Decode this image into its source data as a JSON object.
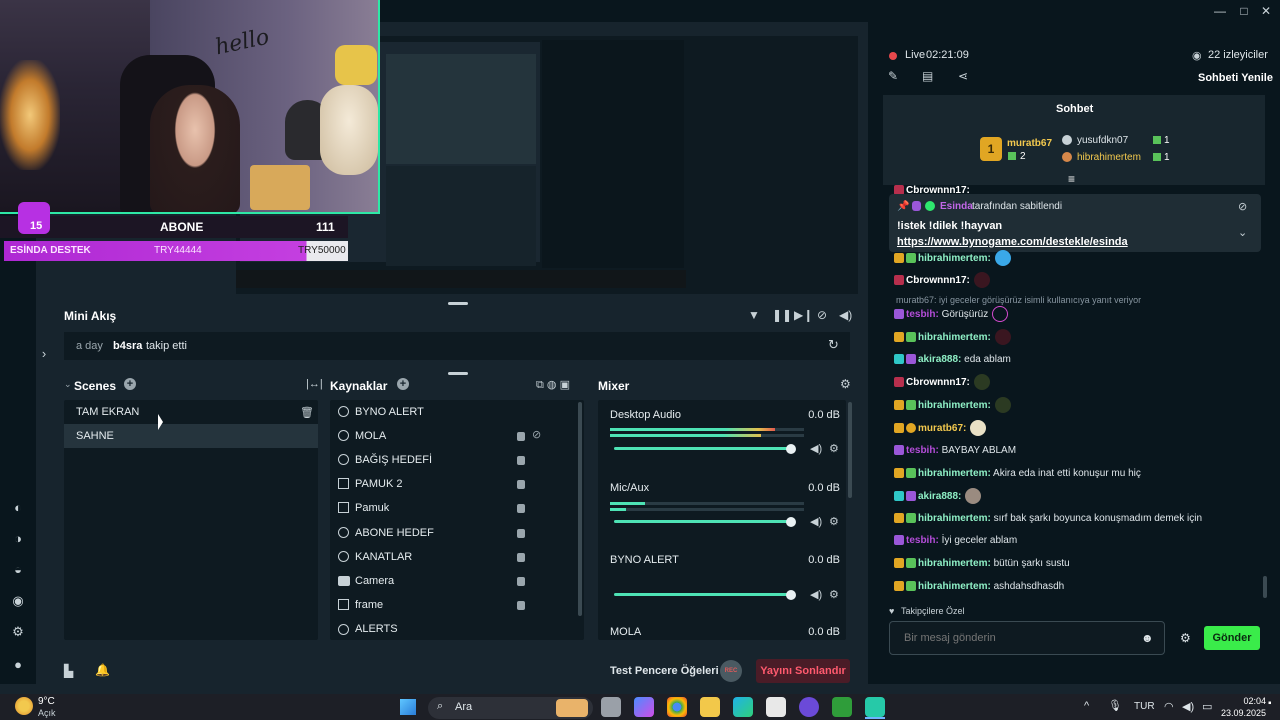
{
  "webcam": {
    "hello_text": "hello",
    "overlay": {
      "badge_number": "15",
      "abone_label": "ABONE",
      "abone_count": "111",
      "destek_label": "ESİNDA DESTEK",
      "destek_amount1": "TRY44444",
      "destek_amount2": "TRY50000"
    }
  },
  "mini_akis": {
    "title": "Mini Akış",
    "time": "a day",
    "user": "b4sra",
    "action": "takip etti"
  },
  "scenes": {
    "title": "Scenes",
    "items": [
      "TAM EKRAN",
      "SAHNE"
    ]
  },
  "sources": {
    "title": "Kaynaklar",
    "items": [
      "BYNO ALERT",
      "MOLA",
      "BAĞIŞ HEDEFİ",
      "PAMUK 2",
      "Pamuk",
      "ABONE HEDEF",
      "KANATLAR",
      "Camera",
      "frame",
      "ALERTS"
    ]
  },
  "mixer": {
    "title": "Mixer",
    "channels": [
      {
        "name": "Desktop Audio",
        "db": "0.0 dB"
      },
      {
        "name": "Mic/Aux",
        "db": "0.0 dB"
      },
      {
        "name": "BYNO ALERT",
        "db": "0.0 dB"
      },
      {
        "name": "MOLA",
        "db": "0.0 dB"
      }
    ]
  },
  "bottom": {
    "test_label": "Test Pencere Öğeleri",
    "rec_label": "REC",
    "end_stream": "Yayını Sonlandır"
  },
  "chat": {
    "live_label": "Live",
    "live_time": "02:21:09",
    "viewers": "22 izleyiciler",
    "refresh": "Sohbeti Yenile",
    "title": "Sohbet",
    "leaderboard": {
      "first_name": "muratb67",
      "first_rank": "1",
      "first_count": "2",
      "second_name": "yusufdkn07",
      "second_count": "1",
      "third_name": "hibrahimertem",
      "third_count": "1"
    },
    "partial_top": "Cbrownnn17:",
    "pinned": {
      "user": "Esinda",
      "suffix": "tarafından sabitlendi",
      "message": "!istek !dilek !hayvan",
      "link": "https://www.bynogame.com/destekle/esinda"
    },
    "reply_context": "muratb67: iyi geceler görüşürüz isimli kullanıcıya yanıt veriyor",
    "messages": [
      {
        "user": "hibrahimertem:",
        "text": ""
      },
      {
        "user": "Cbrownnn17:",
        "text": ""
      },
      {
        "user": "tesbih:",
        "text": "Görüşürüz"
      },
      {
        "user": "hibrahimertem:",
        "text": ""
      },
      {
        "user": "akira888:",
        "text": "eda ablam"
      },
      {
        "user": "Cbrownnn17:",
        "text": ""
      },
      {
        "user": "hibrahimertem:",
        "text": ""
      },
      {
        "user": "muratb67:",
        "text": ""
      },
      {
        "user": "tesbih:",
        "text": "BAYBAY ABLAM"
      },
      {
        "user": "hibrahimertem:",
        "text": "Akira eda inat etti konuşur mu hiç"
      },
      {
        "user": "akira888:",
        "text": ""
      },
      {
        "user": "hibrahimertem:",
        "text": "sırf bak şarkı boyunca konuşmadım demek için"
      },
      {
        "user": "tesbih:",
        "text": "İyi geceler ablam"
      },
      {
        "user": "hibrahimertem:",
        "text": "bütün şarkı sustu"
      },
      {
        "user": "hibrahimertem:",
        "text": "ashdahsdhasdh"
      }
    ],
    "followers_only": "Takipçilere Özel",
    "input_placeholder": "Bir mesaj gönderin",
    "send": "Gönder"
  },
  "taskbar": {
    "weather_temp": "9°C",
    "weather_desc": "Açık",
    "search_label": "Ara",
    "lang": "TUR",
    "time": "02:04",
    "date": "23.09.2025"
  }
}
